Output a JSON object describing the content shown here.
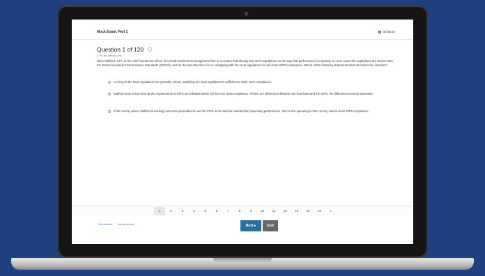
{
  "exam": {
    "title": "Mock Exam: Part 1",
    "timer": "02:50:24"
  },
  "question": {
    "heading": "Question 1 of 120",
    "id": "(1 F57-M01-BB2019-1073)",
    "text": "Giles Stafford, CFA, is the chief investment officer of a small investment management firm in a country that already has strict regulations on the way that performance is reported. In most cases the regulations are stricter than the Global Investment Performance Standards (GIPS®), and he decides that since he is complying with the local regulations he will claim GIPS compliance. Which of the following statements best describes the situation?",
    "options": [
      "As long as the local regulations are generally stricter, satisfying the local regulations is sufficient to claim GIPS compliance.",
      "Stafford must ensure that all the requirements of GIPS are followed before his firm can claim compliance. If there are differences between the local laws and the GIPS, the differences must be disclosed.",
      "If the country where Stafford is working cannot be persuaded to use the GIPS as its national standard for presenting performance, then a firm operating in that country cannot claim GIPS compliance."
    ]
  },
  "pager": {
    "pages": [
      "1",
      "2",
      "3",
      "4",
      "5",
      "6",
      "7",
      "8",
      "9",
      "10",
      "11",
      "12",
      "13",
      "14",
      "15"
    ],
    "current": "1",
    "next_glyph": "▸"
  },
  "footer": {
    "feedback_label": "Give feedback",
    "instructor_label": "Ask an instructor",
    "next_label": "Next ▸",
    "end_label": "End"
  }
}
